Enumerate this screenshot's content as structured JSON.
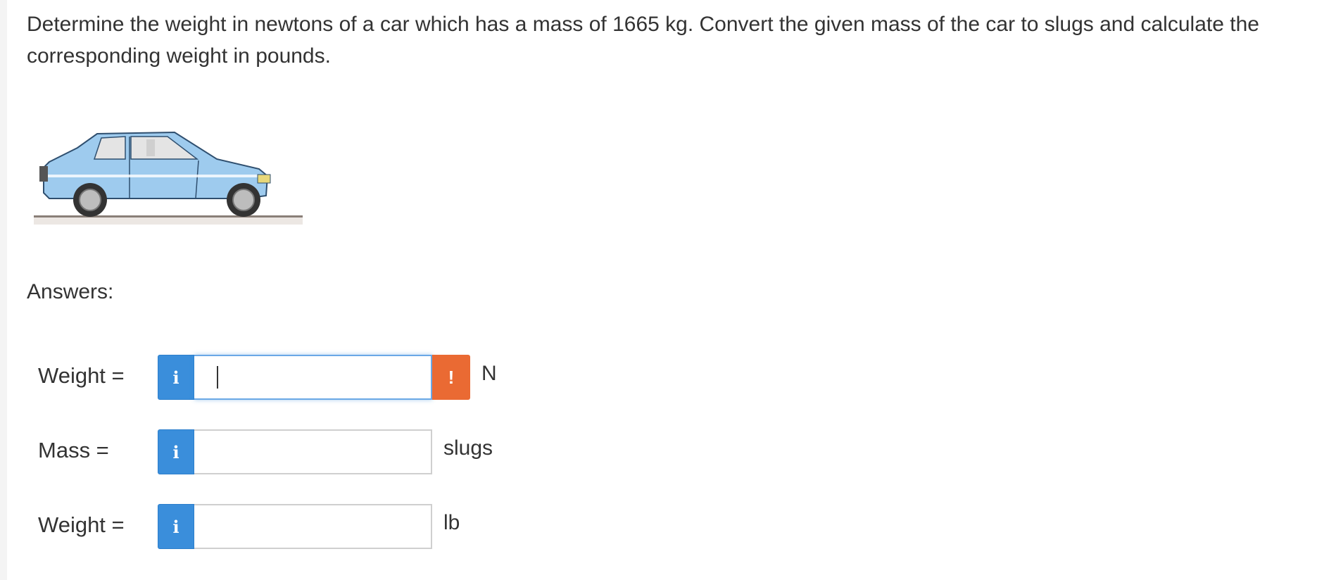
{
  "question": {
    "text": "Determine the weight in newtons of a car which has a mass of 1665 kg. Convert the given mass of the car to slugs and calculate the corresponding weight in pounds."
  },
  "figure": {
    "icon": "car-illustration",
    "body_color": "#9ecbee"
  },
  "answers": {
    "label": "Answers:",
    "rows": [
      {
        "label": "Weight =",
        "info_icon": "i",
        "value": "",
        "status_icon": "!",
        "unit": "N"
      },
      {
        "label": "Mass =",
        "info_icon": "i",
        "value": "",
        "unit": "slugs"
      },
      {
        "label": "Weight =",
        "info_icon": "i",
        "value": "",
        "unit": "lb"
      }
    ]
  },
  "colors": {
    "info": "#3a8edb",
    "warning": "#ea6a33"
  }
}
